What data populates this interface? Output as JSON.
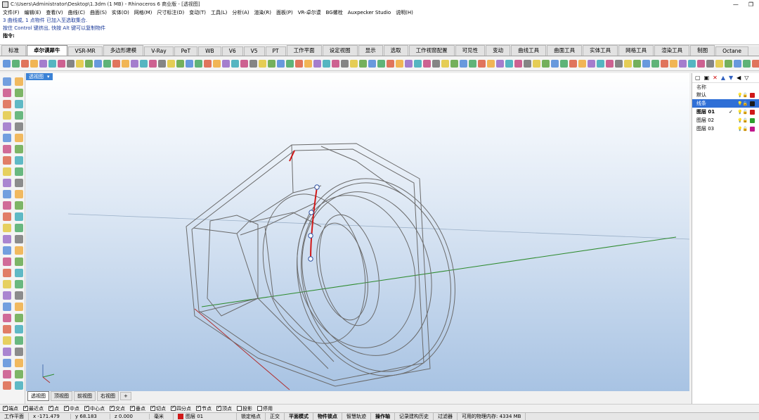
{
  "window": {
    "title": "C:\\Users\\Administrator\\Desktop\\1.3dm (1 MB) - Rhinoceros 6 商业版 - [透视图]",
    "controls": [
      "—",
      "❐"
    ]
  },
  "menu": [
    "文件(F)",
    "编辑(E)",
    "查看(V)",
    "曲线(C)",
    "曲面(S)",
    "实体(O)",
    "网格(M)",
    "尺寸标注(D)",
    "变动(T)",
    "工具(L)",
    "分析(A)",
    "渲染(R)",
    "面板(P)",
    "VR-卓尔谟",
    "BG螺栓",
    "Auxpecker Studio",
    "说明(H)"
  ],
  "command": {
    "line1": "3 曲线或, 1 点物件 已加入至选取集合.",
    "line2": "按住 Control 键挤出, 快按 Alt 键可以复制物件",
    "prompt": "指令:"
  },
  "tabs": [
    "标准",
    "卓尔谟犀牛",
    "VSR-MR",
    "多边形建模",
    "V-Ray",
    "PeT",
    "WB",
    "V6",
    "V5",
    "PT",
    "工作平面",
    "设定视图",
    "显示",
    "选取",
    "工作视窗配置",
    "可见性",
    "变动",
    "曲线工具",
    "曲面工具",
    "实体工具",
    "网格工具",
    "渲染工具",
    "制图",
    "Octane"
  ],
  "active_tab": 1,
  "viewport": {
    "label": "透视图"
  },
  "viewport_tabs": [
    "透视图",
    "顶视图",
    "前视图",
    "右视图",
    "+"
  ],
  "layers": {
    "header": "名称",
    "rows": [
      {
        "name": "默认",
        "check": "",
        "color": "#d01818",
        "selected": false,
        "bold": false
      },
      {
        "name": "线条",
        "check": "",
        "color": "#1a1a1a",
        "selected": true,
        "bold": false
      },
      {
        "name": "图层 01",
        "check": "✓",
        "color": "#d01818",
        "selected": false,
        "bold": true
      },
      {
        "name": "图层 02",
        "check": "",
        "color": "#2ea02e",
        "selected": false,
        "bold": false
      },
      {
        "name": "图层 03",
        "check": "",
        "color": "#c0188c",
        "selected": false,
        "bold": false
      }
    ]
  },
  "osnap": [
    {
      "label": "端点",
      "on": true
    },
    {
      "label": "最近点",
      "on": true
    },
    {
      "label": "点",
      "on": true
    },
    {
      "label": "中点",
      "on": true
    },
    {
      "label": "中心点",
      "on": true
    },
    {
      "label": "交点",
      "on": true
    },
    {
      "label": "垂点",
      "on": true
    },
    {
      "label": "切点",
      "on": true
    },
    {
      "label": "四分点",
      "on": true
    },
    {
      "label": "节点",
      "on": true
    },
    {
      "label": "顶点",
      "on": true
    },
    {
      "label": "投影",
      "on": false
    },
    {
      "label": "停用",
      "on": false
    }
  ],
  "status": {
    "cplane": "工作平面",
    "x": "x -171.479",
    "y": "y 68.183",
    "z": "z 0.000",
    "unit": "毫米",
    "layer": "图层 01",
    "layer_color": "#d01818",
    "buttons": [
      "锁定格点",
      "正交",
      "平面模式",
      "物件锁点",
      "智慧轨迹",
      "操作轴",
      "记录建构历史",
      "过滤器"
    ],
    "bold_buttons": [
      "平面模式",
      "物件锁点",
      "操作轴"
    ],
    "memory": "可用的物理内存: 4334 MB"
  },
  "colors": {
    "selection_red": "#d01818",
    "x_axis": "#b03030",
    "y_axis": "#2e8b2e",
    "wire": "#6a6a6a"
  }
}
